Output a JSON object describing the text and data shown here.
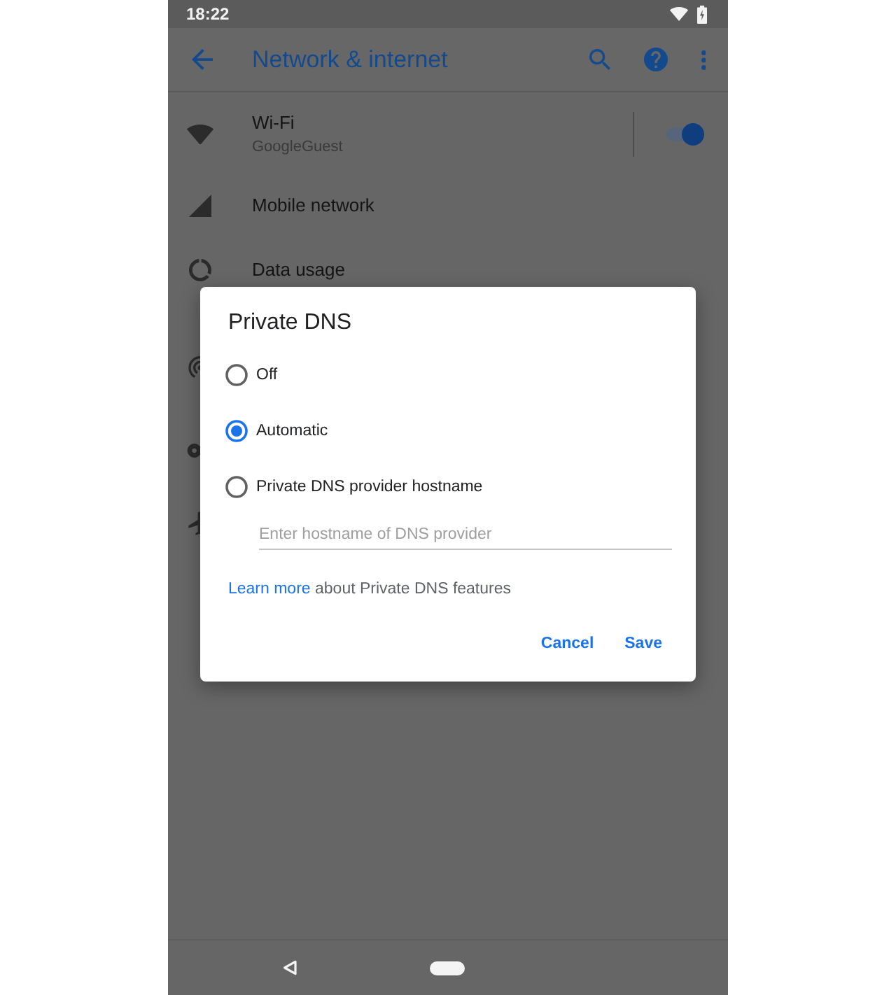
{
  "status_bar": {
    "time": "18:22"
  },
  "app_bar": {
    "title": "Network & internet"
  },
  "settings_list": [
    {
      "kind": "toggle",
      "title": "Wi-Fi",
      "summary": "GoogleGuest",
      "on": true
    },
    {
      "kind": "link",
      "title": "Mobile network"
    },
    {
      "kind": "link",
      "title": "Data usage"
    }
  ],
  "dialog": {
    "title": "Private DNS",
    "options": [
      {
        "label": "Off",
        "selected": false
      },
      {
        "label": "Automatic",
        "selected": true
      },
      {
        "label": "Private DNS provider hostname",
        "selected": false
      }
    ],
    "hostname_field": {
      "placeholder": "Enter hostname of DNS provider"
    },
    "footer": {
      "link": "Learn more",
      "text": "about Private DNS features"
    },
    "buttons": [
      "Cancel",
      "Save"
    ]
  }
}
